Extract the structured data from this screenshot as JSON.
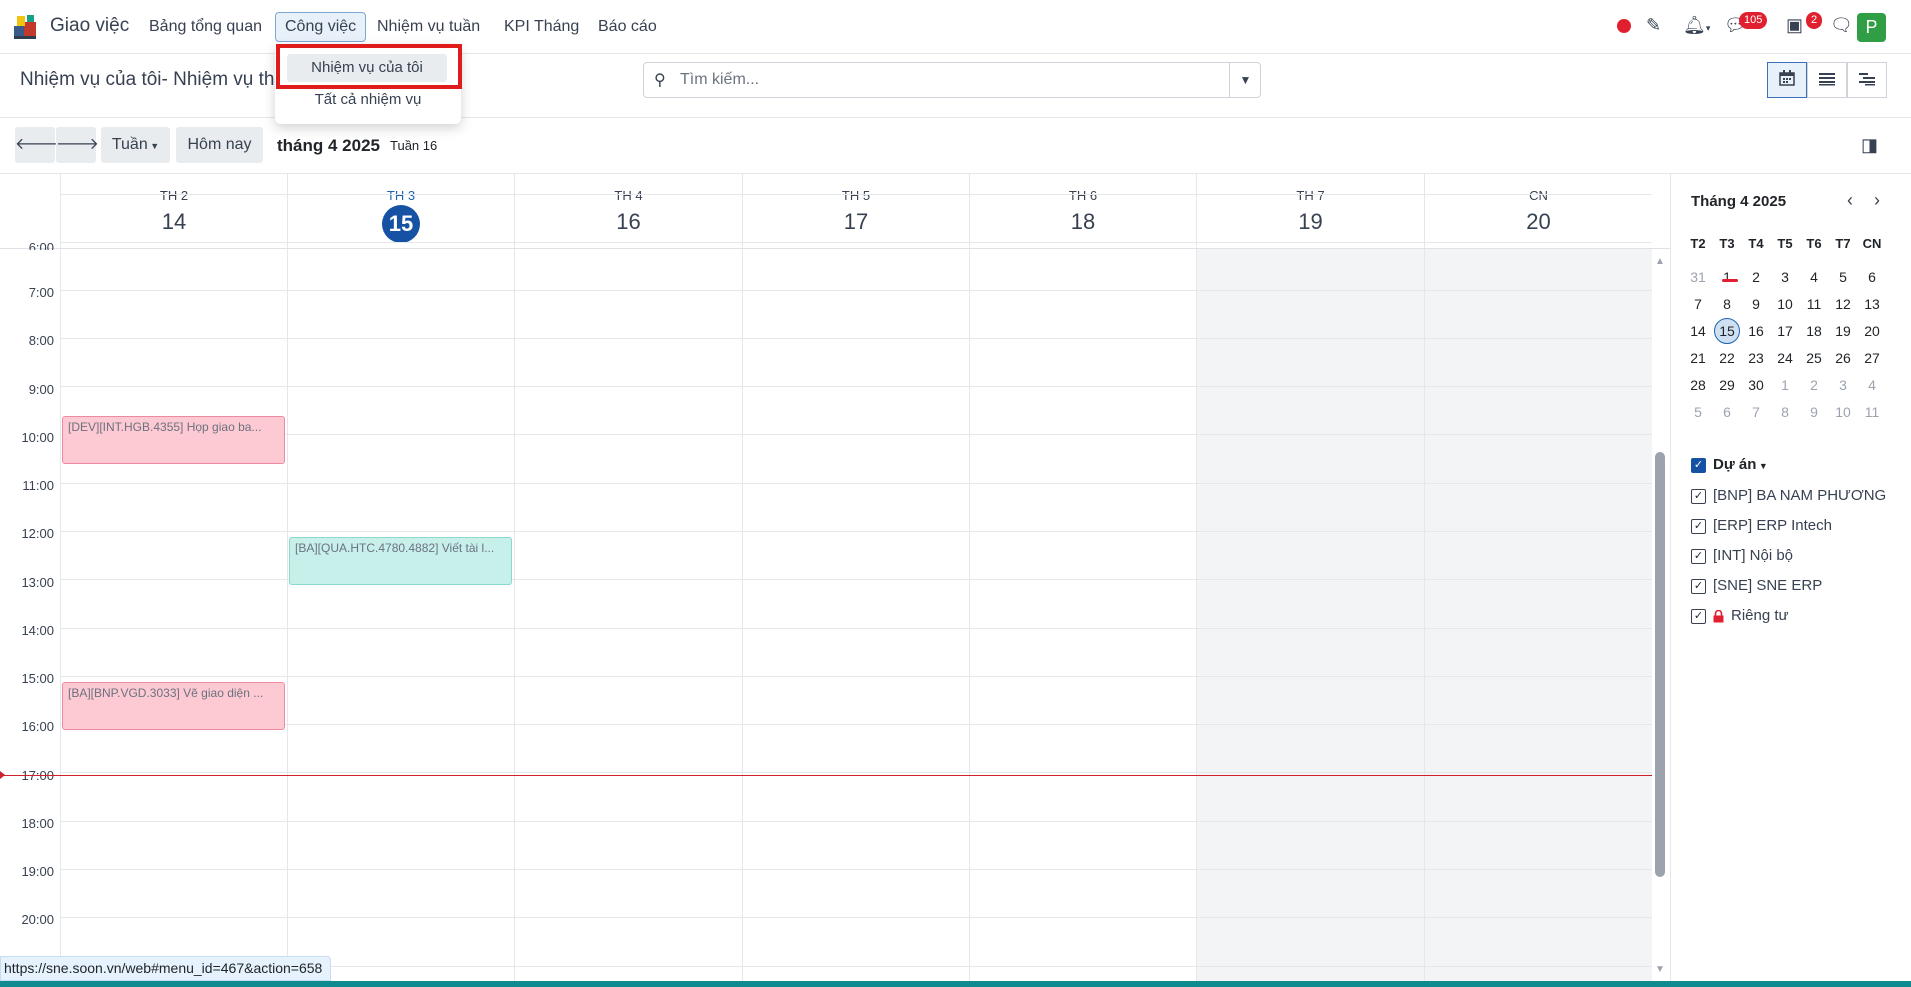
{
  "topnav": {
    "app_title": "Giao việc",
    "menu": [
      "Bảng tổng quan",
      "Công việc",
      "Nhiệm vụ tuần",
      "KPI Tháng",
      "Báo cáo"
    ],
    "messages_badge": "105",
    "activity_badge": "2",
    "avatar_letter": "P"
  },
  "dropdown": {
    "items": [
      "Nhiệm vụ của tôi",
      "Tất cả nhiệm vụ"
    ]
  },
  "control": {
    "title": "Nhiệm vụ của tôi- Nhiệm vụ th",
    "search_placeholder": "Tìm kiếm..."
  },
  "toolbar": {
    "scale_label": "Tuần",
    "today_label": "Hôm nay",
    "period": "tháng 4 2025",
    "week": "Tuần 16"
  },
  "days": [
    {
      "name": "TH 2",
      "num": "14"
    },
    {
      "name": "TH 3",
      "num": "15"
    },
    {
      "name": "TH 4",
      "num": "16"
    },
    {
      "name": "TH 5",
      "num": "17"
    },
    {
      "name": "TH 6",
      "num": "18"
    },
    {
      "name": "TH 7",
      "num": "19"
    },
    {
      "name": "CN",
      "num": "20"
    }
  ],
  "hours": [
    "6:00",
    "7:00",
    "8:00",
    "9:00",
    "10:00",
    "11:00",
    "12:00",
    "13:00",
    "14:00",
    "15:00",
    "16:00",
    "17:00",
    "18:00",
    "19:00",
    "20:00"
  ],
  "events": [
    {
      "title": "[DEV][INT.HGB.4355] Họp giao ba...",
      "color": "pink"
    },
    {
      "title": "[BA][QUA.HTC.4780.4882] Viết tài l...",
      "color": "teal"
    },
    {
      "title": "[BA][BNP.VGD.3033] Vẽ giao diện ...",
      "color": "pink"
    }
  ],
  "mini_calendar": {
    "title": "Tháng 4 2025",
    "weekdays": [
      "T2",
      "T3",
      "T4",
      "T5",
      "T6",
      "T7",
      "CN"
    ],
    "weeks": [
      [
        "31",
        "1",
        "2",
        "3",
        "4",
        "5",
        "6"
      ],
      [
        "7",
        "8",
        "9",
        "10",
        "11",
        "12",
        "13"
      ],
      [
        "14",
        "15",
        "16",
        "17",
        "18",
        "19",
        "20"
      ],
      [
        "21",
        "22",
        "23",
        "24",
        "25",
        "26",
        "27"
      ],
      [
        "28",
        "29",
        "30",
        "1",
        "2",
        "3",
        "4"
      ],
      [
        "5",
        "6",
        "7",
        "8",
        "9",
        "10",
        "11"
      ]
    ]
  },
  "filters": {
    "heading": "Dự án",
    "items": [
      "[BNP] BA NAM PHƯƠNG",
      "[ERP] ERP Intech",
      "[INT] Nội bộ",
      "[SNE] SNE ERP",
      "Riêng tư"
    ]
  },
  "statusbar": "https://sne.soon.vn/web#menu_id=467&action=658"
}
